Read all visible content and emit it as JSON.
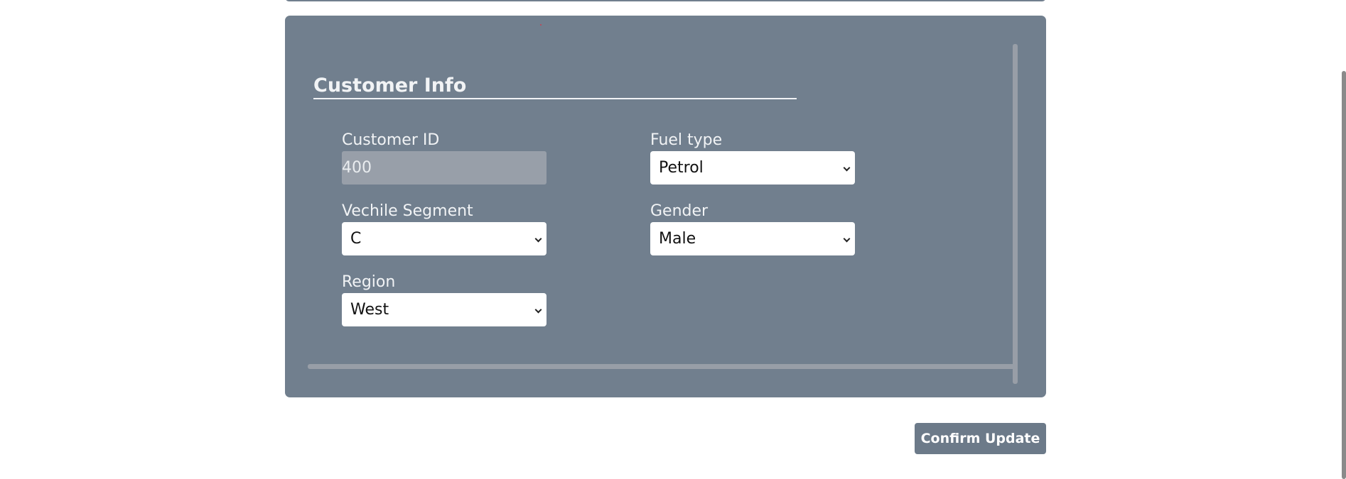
{
  "section": {
    "title": "Customer Info"
  },
  "fields": {
    "customer_id": {
      "label": "Customer ID",
      "value": "400"
    },
    "fuel_type": {
      "label": "Fuel type",
      "selected": "Petrol"
    },
    "vehicle_segment": {
      "label": "Vechile Segment",
      "selected": "C"
    },
    "gender": {
      "label": "Gender",
      "selected": "Male"
    },
    "region": {
      "label": "Region",
      "selected": "West"
    }
  },
  "actions": {
    "confirm_label": "Confirm Update"
  },
  "colors": {
    "card_background": "#717f8e",
    "button_background": "#6c7a89",
    "readonly_input_background": "#989fa9"
  }
}
